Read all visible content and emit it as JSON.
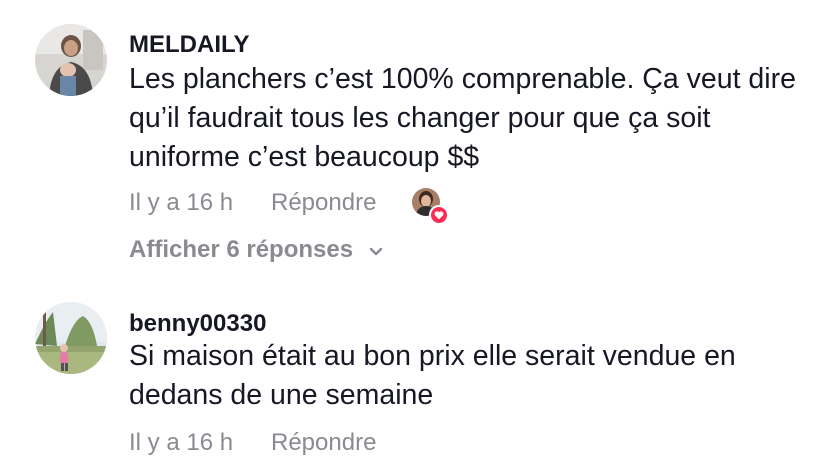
{
  "comments": [
    {
      "username": "MELDAILY",
      "text": "Les planchers c’est 100% comprenable. Ça veut dire qu’il faudrait tous les changer pour que ça soit uniforme c’est beaucoup $$",
      "time": "Il y a 16 h",
      "reply_label": "Répondre",
      "view_replies_label": "Afficher 6 réponses"
    },
    {
      "username": "benny00330",
      "text": "Si maison était au bon prix elle serait vendue en dedans de une semaine",
      "time": "Il y a 16 h",
      "reply_label": "Répondre"
    }
  ]
}
